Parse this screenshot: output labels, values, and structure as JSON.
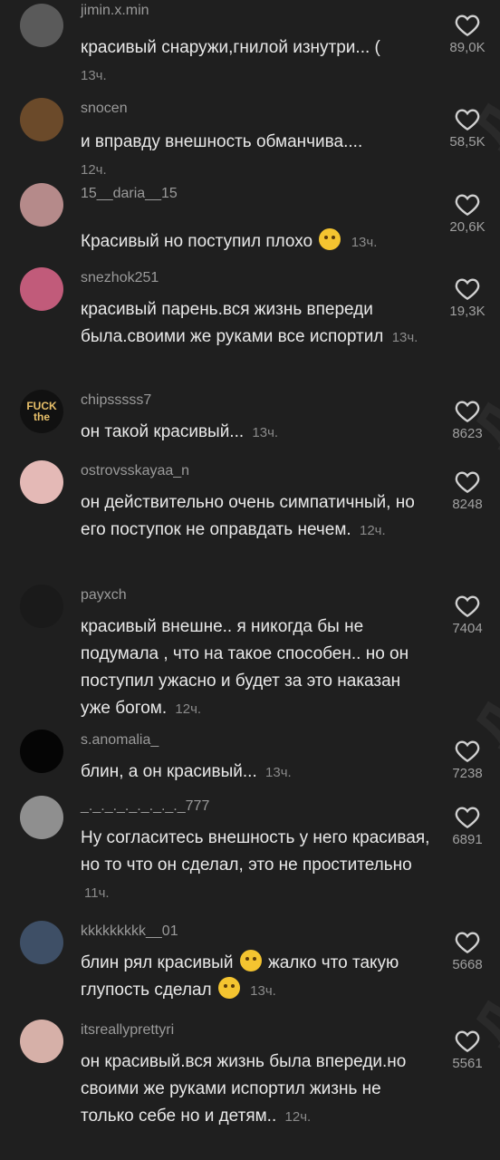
{
  "watermark": "Двач",
  "comments": [
    {
      "username": "jimin.x.min",
      "text": "красивый снаружи,гнилой изнутри... (",
      "time": "13ч.",
      "likes": "89,0K",
      "avatar_color": "#5a5a5a"
    },
    {
      "username": "snocen",
      "text": "и вправду внешность обманчива....",
      "time": "12ч.",
      "likes": "58,5K",
      "avatar_color": "#6b4a2a"
    },
    {
      "username": "15__daria__15",
      "text": "Красивый но поступил плохо",
      "emoji_after": "pensive-emoji",
      "time": "13ч.",
      "likes": "20,6K",
      "avatar_color": "#b58a8a"
    },
    {
      "username": "snezhok251",
      "text": "красивый парень.вся жизнь впереди была.своими же руками все испортил",
      "time": "13ч.",
      "likes": "19,3K",
      "avatar_color": "#c15b7a"
    },
    {
      "username": "chipsssss7",
      "text": "он такой красивый...",
      "time": "13ч.",
      "likes": "8623",
      "avatar_color": "#111111",
      "avatar_text": "FUCK the"
    },
    {
      "username": "ostrovsskayaa_n",
      "text": "он действительно очень симпатичный, но его поступок не оправдать нечем.",
      "time": "12ч.",
      "likes": "8248",
      "avatar_color": "#e4b9b6"
    },
    {
      "username": "payxch",
      "text": "красивый внешне.. я никогда бы не подумала , что на такое способен.. но он поступил ужасно и будет за это наказан уже богом.",
      "time": "12ч.",
      "likes": "7404",
      "avatar_color": "#1a1a1a"
    },
    {
      "username": "s.anomalia_",
      "text": "блин, а он красивый...",
      "time": "13ч.",
      "likes": "7238",
      "avatar_color": "#050505"
    },
    {
      "username": "_._._._._._._._._777",
      "text": "Ну согласитесь внешность у него красивая, но то что он сделал, это не простительно",
      "time": "11ч.",
      "likes": "6891",
      "avatar_color": "#8f8f8f"
    },
    {
      "username": "kkkkkkkkk__01",
      "text_parts": [
        "блин рял красивый",
        " жалко что такую глупость сделал"
      ],
      "time": "13ч.",
      "likes": "5668",
      "avatar_color": "#3e4f66"
    },
    {
      "username": "itsreallyprettyri",
      "text": "он красивый.вся жизнь была впереди.но своими же руками испортил жизнь не только себе но и детям..",
      "time": "12ч.",
      "likes": "5561",
      "avatar_color": "#d6b0a8"
    }
  ]
}
